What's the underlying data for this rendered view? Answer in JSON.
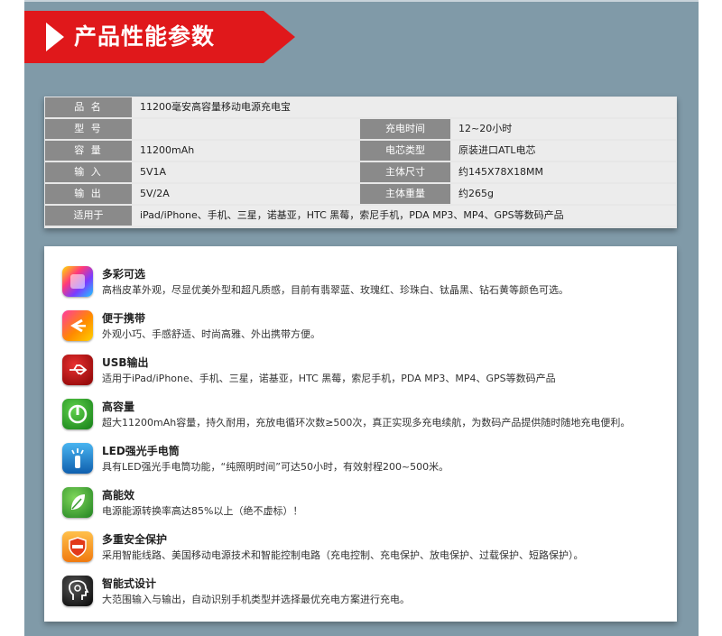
{
  "banner": {
    "title": "产品性能参数"
  },
  "spec": {
    "rows": [
      {
        "label": "品 名",
        "value": "11200毫安高容量移动电源充电宝"
      },
      {
        "label": "型 号",
        "value": "",
        "label2": "充电时间",
        "value2": "12~20小时"
      },
      {
        "label": "容 量",
        "value": "11200mAh",
        "label2": "电芯类型",
        "value2": "原装进口ATL电芯"
      },
      {
        "label": "输 入",
        "value": "5V1A",
        "label2": "主体尺寸",
        "value2": "约145X78X18MM"
      },
      {
        "label": "输 出",
        "value": "5V/2A",
        "label2": "主体重量",
        "value2": "约265g"
      },
      {
        "label": "适用于",
        "value": "iPad/iPhone、手机、三星，诺基亚，HTC 黑莓，索尼手机，PDA MP3、MP4、GPS等数码产品"
      }
    ]
  },
  "features": [
    {
      "icon": "color-palette-icon",
      "title": "多彩可选",
      "desc": "高档皮革外观，尽显优美外型和超凡质感，目前有翡翠蓝、玫瑰红、珍珠白、钛晶黑、钻石黄等颜色可选。"
    },
    {
      "icon": "portable-icon",
      "title": "便于携带",
      "desc": "外观小巧、手感舒适、时尚高雅、外出携带方便。"
    },
    {
      "icon": "usb-icon",
      "title": "USB输出",
      "desc": "适用于iPad/iPhone、手机、三星，诺基亚，HTC 黑莓，索尼手机，PDA MP3、MP4、GPS等数码产品"
    },
    {
      "icon": "power-capacity-icon",
      "title": "高容量",
      "desc": "超大11200mAh容量，持久耐用，充放电循环次数≥500次，真正实现多充电续航，为数码产品提供随时随地充电便利。"
    },
    {
      "icon": "flashlight-icon",
      "title": "LED强光手电筒",
      "desc": "具有LED强光手电筒功能，“纯照明时间”可达50小时，有效射程200~500米。"
    },
    {
      "icon": "leaf-icon",
      "title": "高能效",
      "desc": "电源能源转换率高达85%以上（绝不虚标）！"
    },
    {
      "icon": "safety-shield-icon",
      "title": "多重安全保护",
      "desc": "采用智能线路、美国移动电源技术和智能控制电路（充电控制、充电保护、放电保护、过载保护、短路保护）。"
    },
    {
      "icon": "smart-head-icon",
      "title": "智能式设计",
      "desc": "大范围输入与输出，自动识别手机类型并选择最优充电方案进行充电。"
    }
  ]
}
